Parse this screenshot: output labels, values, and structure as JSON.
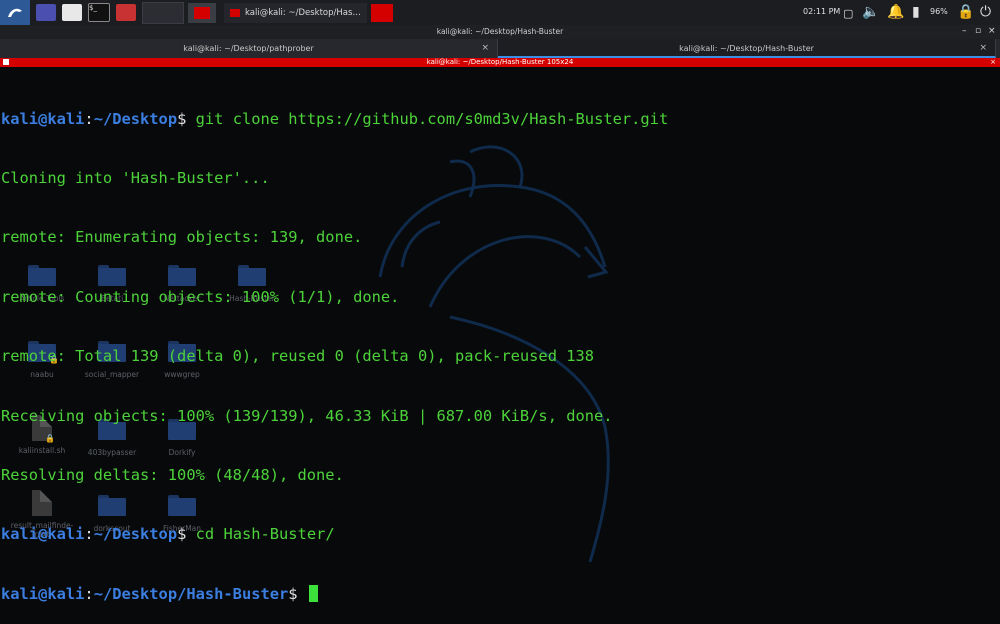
{
  "panel": {
    "task_title": "kali@kali: ~/Desktop/Has…",
    "clock": "02:11 PM",
    "battery": "96%"
  },
  "window": {
    "title": "kali@kali: ~/Desktop/Hash-Buster",
    "tabs": [
      {
        "label": "kali@kali: ~/Desktop/pathprober"
      },
      {
        "label": "kali@kali: ~/Desktop/Hash-Buster"
      }
    ],
    "inner_title": "kali@kali: ~/Desktop/Hash-Buster 105x24"
  },
  "terminal": {
    "prompt_user": "kali@kali",
    "prompt_sep": ":",
    "lines": [
      {
        "path": "~/Desktop",
        "cmd": " git clone https://github.com/s0md3v/Hash-Buster.git"
      },
      {
        "out": "Cloning into 'Hash-Buster'..."
      },
      {
        "out": "remote: Enumerating objects: 139, done."
      },
      {
        "out": "remote: Counting objects: 100% (1/1), done."
      },
      {
        "out": "remote: Total 139 (delta 0), reused 0 (delta 0), pack-reused 138"
      },
      {
        "out": "Receiving objects: 100% (139/139), 46.33 KiB | 687.00 KiB/s, done."
      },
      {
        "out": "Resolving deltas: 100% (48/48), done."
      },
      {
        "path": "~/Desktop",
        "cmd": " cd Hash-Buster/"
      },
      {
        "path": "~/Desktop/Hash-Buster",
        "cmd": " "
      }
    ]
  },
  "desktop": {
    "icons": [
      {
        "label": "Article Tools",
        "kind": "folder"
      },
      {
        "label": "Betati",
        "kind": "folder"
      },
      {
        "label": "Nettacker",
        "kind": "folder"
      },
      {
        "label": "Hash-Buster",
        "kind": "folder"
      },
      {
        "label": "naabu",
        "kind": "folder-locked"
      },
      {
        "label": "social_mapper",
        "kind": "folder"
      },
      {
        "label": "wwwgrep",
        "kind": "folder"
      },
      {
        "label": "kaliinstall.sh",
        "kind": "file-locked"
      },
      {
        "label": "403bypasser",
        "kind": "folder"
      },
      {
        "label": "Dorkify",
        "kind": "folder"
      },
      {
        "label": "result_mailfinde-r.txt",
        "kind": "file"
      },
      {
        "label": "dorkscout",
        "kind": "folder"
      },
      {
        "label": "FisherMan",
        "kind": "folder"
      }
    ]
  },
  "colors": {
    "prompt": "#3c7ee0",
    "output": "#4dd33a",
    "accent_red": "#d40000"
  }
}
